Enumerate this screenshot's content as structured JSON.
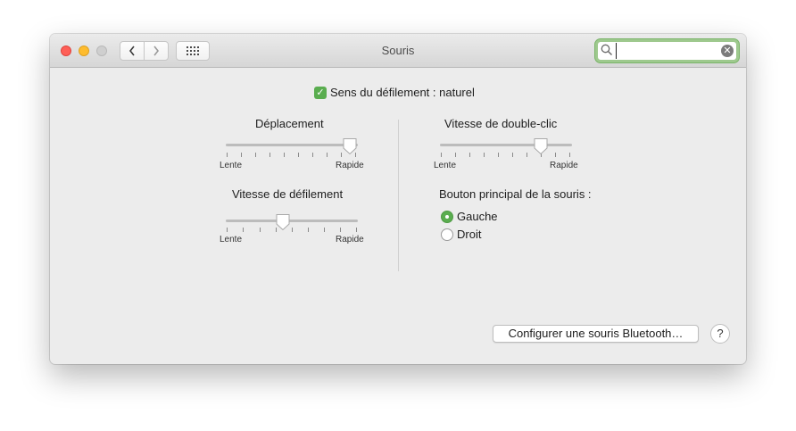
{
  "window": {
    "title": "Souris",
    "search": {
      "value": "",
      "placeholder": ""
    }
  },
  "icons": {
    "back": "chevron-left-icon",
    "forward": "chevron-right-icon",
    "grid": "grid-icon",
    "search": "magnifier-icon",
    "clear": "clear-icon"
  },
  "natural_scroll": {
    "label": "Sens du défilement : naturel",
    "checked": true
  },
  "tracking": {
    "label": "Déplacement",
    "min_label": "Lente",
    "max_label": "Rapide",
    "value_fraction": 0.93
  },
  "scroll_speed": {
    "label": "Vitesse de défilement",
    "min_label": "Lente",
    "max_label": "Rapide",
    "value_fraction": 0.42
  },
  "double_click": {
    "label": "Vitesse de double-clic",
    "min_label": "Lente",
    "max_label": "Rapide",
    "value_fraction": 0.77
  },
  "primary_button": {
    "label": "Bouton principal de la souris :",
    "options": [
      {
        "label": "Gauche",
        "selected": true
      },
      {
        "label": "Droit",
        "selected": false
      }
    ]
  },
  "bluetooth_button": {
    "label": "Configurer une souris Bluetooth…"
  },
  "help_button": {
    "label": "?"
  },
  "colors": {
    "accent": "#5aad4f",
    "search_focus": "#9ec98e"
  }
}
